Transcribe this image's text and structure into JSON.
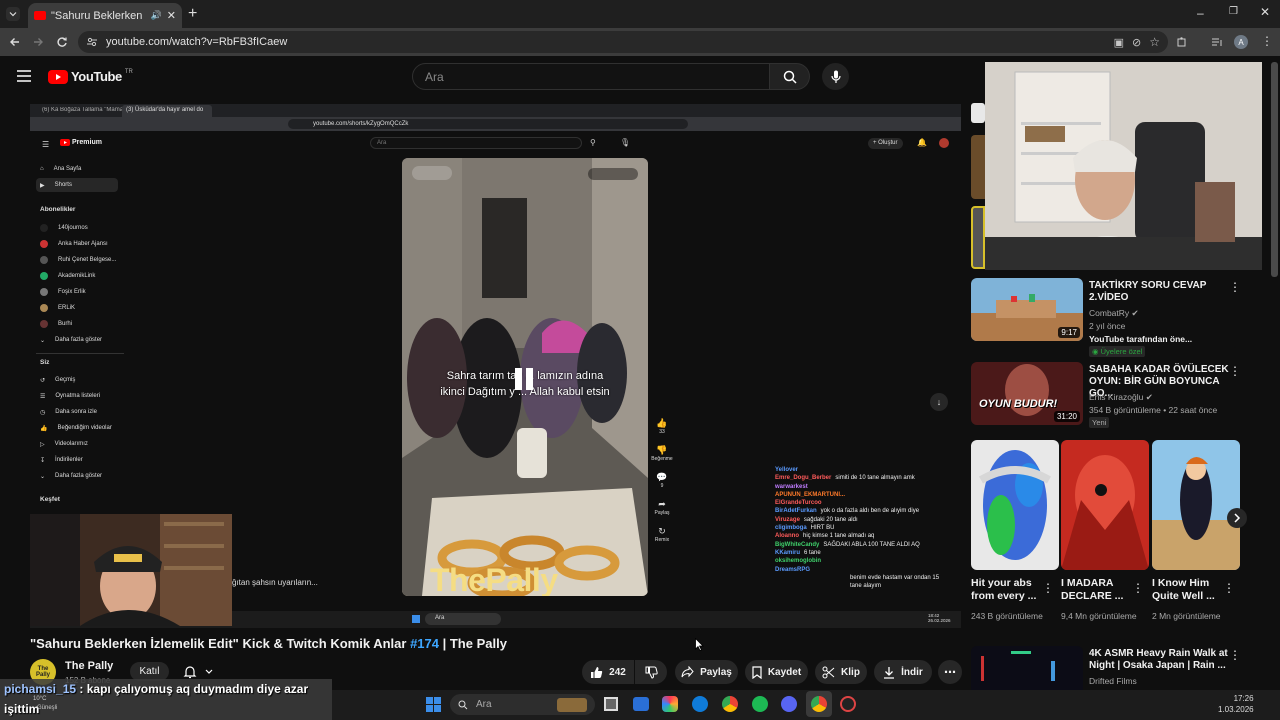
{
  "browser": {
    "tab_title": "\"Sahuru Beklerken İzlemeli",
    "url": "youtube.com/watch?v=RbFB3fICaew",
    "profile_initial": "A"
  },
  "youtube": {
    "logo_text": "YouTube",
    "country_code": "TR",
    "search_placeholder": "Ara"
  },
  "player": {
    "inner_browser": {
      "tab1": "(6) Kä Boğaza Tallama \"Mama'da",
      "tab2": "(3) Üsküdar'da hayır amel do",
      "url": "youtube.com/shorts/kZygOmQCcZk",
      "search_placeholder": "Ara",
      "create_label": "Oluştur",
      "logo_text": "Premium",
      "nav": [
        "Ana Sayfa",
        "Shorts"
      ],
      "subscriptions_label": "Abonelikler",
      "subscriptions": [
        "140journos",
        "Anka Haber Ajansı",
        "Ruhi Çenet Belgese...",
        "AkademikLink",
        "Foşix Erlik",
        "ERLiK",
        "Burhi",
        "Daha fazla göster"
      ],
      "you_label": "Siz",
      "you_items": [
        "Geçmiş",
        "Oynatma listeleri",
        "Daha sonra izle",
        "Beğendiğim videolar",
        "Videolarımız",
        "İndirilenler",
        "Daha fazla göster"
      ],
      "explore_label": "Keşfet",
      "short_actions": {
        "likes": "33",
        "dislike": "Beğenme",
        "comments": "9",
        "share": "Paylaş",
        "remix": "Remix"
      }
    },
    "caption_line1": "Sahra tarım tav  ... lamızın adına",
    "caption_line2": "ikinci Dağıtım y  ... Allah kabul etsin",
    "watermark": "ThePally",
    "overlay_text": "ğıtan şahsın uyarıların...",
    "chat": [
      {
        "user": "Yellover",
        "color": "#5b9bff",
        "msg": ""
      },
      {
        "user": "Emre_Dogu_Berber",
        "color": "#ff5b5b",
        "msg": "simiti de 10 tane almayın amk"
      },
      {
        "user": "warwarkest",
        "color": "#c07dff",
        "msg": ""
      },
      {
        "user": "APUNUN_EKMARTUNI...",
        "color": "#ff7a2a",
        "msg": ""
      },
      {
        "user": "ElGrandeTurcoo",
        "color": "#ff5b5b",
        "msg": ""
      },
      {
        "user": "BirAdetFurkan",
        "color": "#5b9bff",
        "msg": "yok o da fazla aldı ben de alıyim diye"
      },
      {
        "user": "Viruzage",
        "color": "#ff5b5b",
        "msg": "sağdaki 20 tane aldı"
      },
      {
        "user": "cligimboga",
        "color": "#5b9bff",
        "msg": "HIRT BU"
      },
      {
        "user": "Aloanno",
        "color": "#ff5b5b",
        "msg": "hiç kimse 1 tane almadı aq"
      },
      {
        "user": "BigWhiteCandy",
        "color": "#3fd16b",
        "msg": "SAĞDAKI ABLA 100 TANE ALDI AQ"
      },
      {
        "user": "KKamiru",
        "color": "#5b9bff",
        "msg": "6 tane"
      },
      {
        "user": "oksihemoglobin",
        "color": "#3fd16b",
        "msg": ""
      },
      {
        "user": "DreamsRPG",
        "color": "#5b9bff",
        "msg": ""
      },
      {
        "user": "",
        "color": "#ffffff",
        "msg": "benim evde hastam var ondan 15"
      },
      {
        "user": "",
        "color": "#ffffff",
        "msg": "tane alayım"
      }
    ],
    "inner_clock": "18:42",
    "inner_date": "26.02.2026"
  },
  "video": {
    "title_main": "\"Sahuru Beklerken İzlemelik Edit\" Kick & Twitch Komik Anlar",
    "title_tag": "#174",
    "title_suffix": "| The Pally",
    "channel_name": "The Pally",
    "channel_avatar_text": "The Pally",
    "subscribers": "152 B abone",
    "subscribed_label": "Katıl",
    "likes": "242",
    "share_label": "Paylaş",
    "save_label": "Kaydet",
    "clip_label": "Klip",
    "download_label": "İndir"
  },
  "recommendations": [
    {
      "title": "TAKTİKRY SORU CEVAP 2.VİDEO",
      "channel": "CombatRy",
      "meta1": "2 yıl önce",
      "meta2": "YouTube tarafından öne...",
      "badge": "Üyelere özel",
      "duration": "9:17"
    },
    {
      "title": "SABAHA KADAR ÖVÜLECEK OYUN: BİR GÜN BOYUNCA GO...",
      "channel": "Enis Kirazoğlu",
      "meta1": "354 B görüntüleme • 22 saat önce",
      "badge": "Yeni",
      "duration": "31:20",
      "thumb_text": "OYUN BUDUR!"
    }
  ],
  "shorts": [
    {
      "title": "Hit your abs from every ...",
      "views": "243 B görüntüleme"
    },
    {
      "title": "I MADARA DECLARE ...",
      "views": "9,4 Mn görüntüleme"
    },
    {
      "title": "I Know Him Quite Well ...",
      "views": "2 Mn görüntüleme"
    }
  ],
  "rec_bottom": {
    "title": "4K ASMR Heavy Rain Walk at Night | Osaka Japan | Rain ...",
    "channel": "Drifted Films"
  },
  "chat_overlay": {
    "user": "pichamsi_15",
    "message": ": kapı çalıyomuş aq duymadım diye azar",
    "message2": "işittim",
    "weather": "10°C",
    "weather_desc": "Güneşli"
  },
  "taskbar": {
    "search_placeholder": "Ara",
    "time": "17:26",
    "date": "1.03.2026"
  }
}
